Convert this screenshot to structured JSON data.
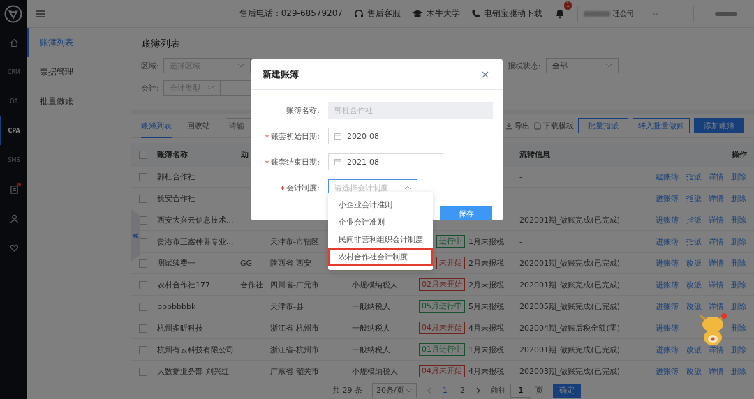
{
  "top_bar": {
    "hotline": "售后电话：029-68579207",
    "links": [
      "售后客服",
      "木牛大学",
      "电销宝驱动下载"
    ],
    "notifications": "1",
    "company": "理公司"
  },
  "rail": [
    {
      "kind": "home",
      "selected": false
    },
    {
      "kind": "text",
      "label": "CRM",
      "selected": false
    },
    {
      "kind": "text",
      "label": "OA",
      "selected": false
    },
    {
      "kind": "text",
      "label": "CPA",
      "selected": true
    },
    {
      "kind": "text",
      "label": "SMS",
      "selected": false
    },
    {
      "kind": "document",
      "selected": false,
      "badge": true
    },
    {
      "kind": "user",
      "selected": false
    },
    {
      "kind": "heart",
      "selected": false
    }
  ],
  "sidebar": {
    "items": [
      {
        "label": "账簿列表",
        "selected": true
      },
      {
        "label": "票据管理",
        "selected": false
      },
      {
        "label": "批量做账",
        "selected": false
      }
    ]
  },
  "page_title": "账簿列表",
  "filters": {
    "region": {
      "label": "区域:",
      "placeholder": "选择区域"
    },
    "accounting": {
      "label": "会计:",
      "placeholder": "会计类型"
    },
    "tax_status": {
      "label": "报税状态:",
      "value": "全部"
    }
  },
  "tabs": [
    {
      "label": "账簿列表",
      "selected": true
    },
    {
      "label": "回收站",
      "selected": false
    }
  ],
  "search": {
    "placeholder": "请输"
  },
  "toolbar": {
    "links": [
      "导出",
      "下载模板"
    ],
    "buttons": [
      {
        "label": "批量指派",
        "primary": false
      },
      {
        "label": "转入批量做账",
        "primary": false
      },
      {
        "label": "添加账簿",
        "primary": true
      }
    ]
  },
  "table": {
    "all_checked": false,
    "columns": [
      "账簿名称",
      "助",
      "流转信息",
      "操作"
    ],
    "rows": [
      {
        "checked": false,
        "name": "郭杜合作社",
        "flow": "-",
        "actions": [
          "建账簿",
          "指派",
          "详情",
          "删除"
        ]
      },
      {
        "checked": false,
        "name": "长安合作社",
        "flow": "-",
        "actions": [
          "进账簿",
          "指派",
          "详情",
          "删除"
        ]
      },
      {
        "checked": false,
        "name": "西安大兴云信息技术...",
        "flow": "202001期_做账完成(已完成)",
        "actions": [
          "进账簿",
          "指派",
          "详情",
          "删除"
        ]
      },
      {
        "checked": false,
        "name": "贵港市正鑫种养专业...",
        "region": "天津市-市辖区",
        "status": {
          "text": "进行中",
          "kind": "in_progress"
        },
        "tax": "1月未报税",
        "flow": "-",
        "actions": [
          "进账簿",
          "指派",
          "详情",
          "删除"
        ]
      },
      {
        "checked": false,
        "name": "测试续费一",
        "mnemonic": "GG",
        "region": "陕西省-西安",
        "status": {
          "text": "未开始",
          "kind": "not_started"
        },
        "tax": "2月未报税",
        "flow": "202001期_做账完成(已完成)",
        "actions": [
          "进账簿",
          "改派",
          "详情",
          "删除"
        ]
      },
      {
        "checked": false,
        "name": "农村合作社177",
        "mnemonic": "合作社",
        "region": "四川省-广元市",
        "type": "小规模纳税人",
        "status": {
          "text": "02月未开始",
          "kind": "not_started"
        },
        "tax": "2月未报税",
        "flow": "202001期_做账完成(已完成)",
        "actions": [
          "进账簿",
          "改派",
          "详情",
          "删除"
        ]
      },
      {
        "checked": false,
        "name": "bbbbbbbk",
        "region": "天津市-县",
        "type": "一般纳税人",
        "status": {
          "text": "05月进行中",
          "kind": "in_progress"
        },
        "tax": "5月未报税",
        "flow": "202005期_做账完成(已完成)",
        "actions": [
          "进账簿",
          "改派",
          "详情",
          "删除"
        ]
      },
      {
        "checked": false,
        "name": "杭州多昕科技",
        "region": "浙江省-杭州市",
        "type": "一般纳税人",
        "status": {
          "text": "04月未开始",
          "kind": "not_started"
        },
        "tax": "4月未报税",
        "flow": "202004期_做账后税金额(零)",
        "actions": [
          "进账簿",
          "删除"
        ]
      },
      {
        "checked": false,
        "name": "杭州有云科技有限公司",
        "region": "浙江省-杭州市",
        "type": "一般纳税人",
        "status": {
          "text": "01月进行中",
          "kind": "in_progress"
        },
        "tax": "1月未报税",
        "flow": "202001期_做账完成(已完成)",
        "actions": [
          "进账簿",
          "改派",
          "详情",
          "删除"
        ]
      },
      {
        "checked": false,
        "name": "大数据业务部-刘兴红",
        "region": "广东省-韶关市",
        "type": "小规模纳税人",
        "status": {
          "text": "04月未开始",
          "kind": "not_started"
        },
        "tax": "4月未报税",
        "flow": "202003期_做账完成(已完成)",
        "actions": [
          "进账簿",
          "改派",
          "详情",
          "删除"
        ]
      }
    ]
  },
  "pagination": {
    "total": "共 29 条",
    "page_size": "20条/页",
    "pages": [
      {
        "label": "1",
        "selected": true
      },
      {
        "label": "2",
        "selected": false
      }
    ],
    "goto_label": "前往",
    "goto_value": "1",
    "page_unit": "页",
    "confirm": "确定"
  },
  "modal": {
    "title": "新建账簿",
    "fields": [
      {
        "kind": "text",
        "label": "账簿名称:",
        "disabled": true,
        "value": "郭杜合作社"
      },
      {
        "kind": "date",
        "label": "账套初始日期:",
        "required": true,
        "value": "2020-08"
      },
      {
        "kind": "date",
        "label": "账套结束日期:",
        "required": true,
        "value": "2021-08"
      },
      {
        "kind": "select",
        "label": "会计制度:",
        "required": true,
        "placeholder": "请选择会计制度",
        "expanded": true
      }
    ],
    "save": "保存"
  },
  "dropdown": {
    "options": [
      {
        "label": "小企业会计准则",
        "highlighted": false
      },
      {
        "label": "企业会计准则",
        "highlighted": false
      },
      {
        "label": "民间非营利组织会计制度",
        "highlighted": false
      },
      {
        "label": "农村合作社会计制度",
        "highlighted": true
      }
    ]
  }
}
